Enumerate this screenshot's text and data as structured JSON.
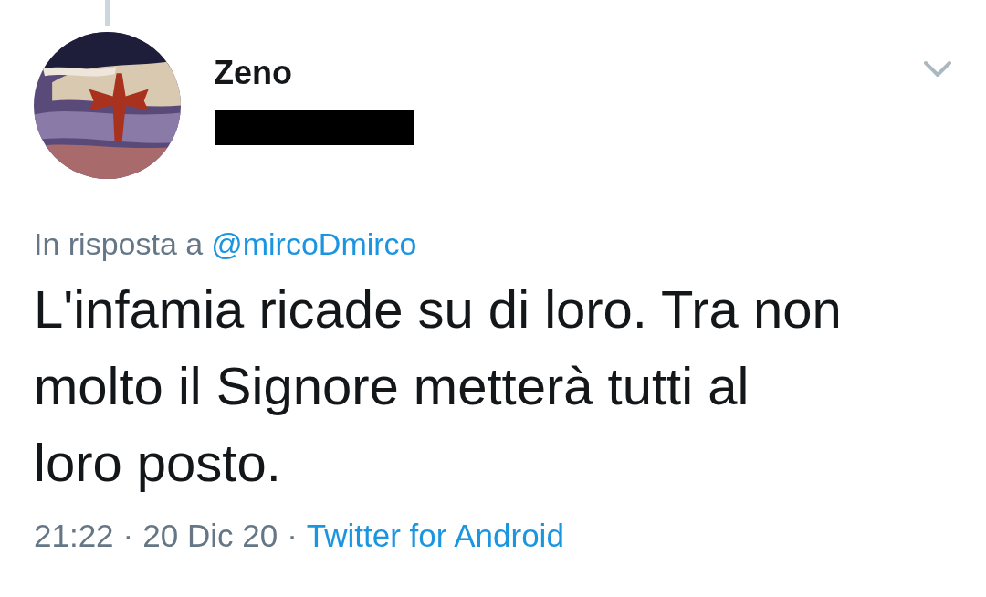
{
  "tweet": {
    "author": {
      "name": "Zeno",
      "handle_redacted": true
    },
    "reply_to": {
      "prefix": "In risposta a",
      "mention": "@mircoDmirco"
    },
    "text_lines": [
      "L'infamia ricade su di loro. Tra non",
      "molto il Signore metterà tutti al",
      "loro posto."
    ],
    "meta": {
      "time": "21:22",
      "separator_1": "·",
      "date": "20 Dic 20",
      "separator_2": "·",
      "source": "Twitter for Android"
    }
  }
}
